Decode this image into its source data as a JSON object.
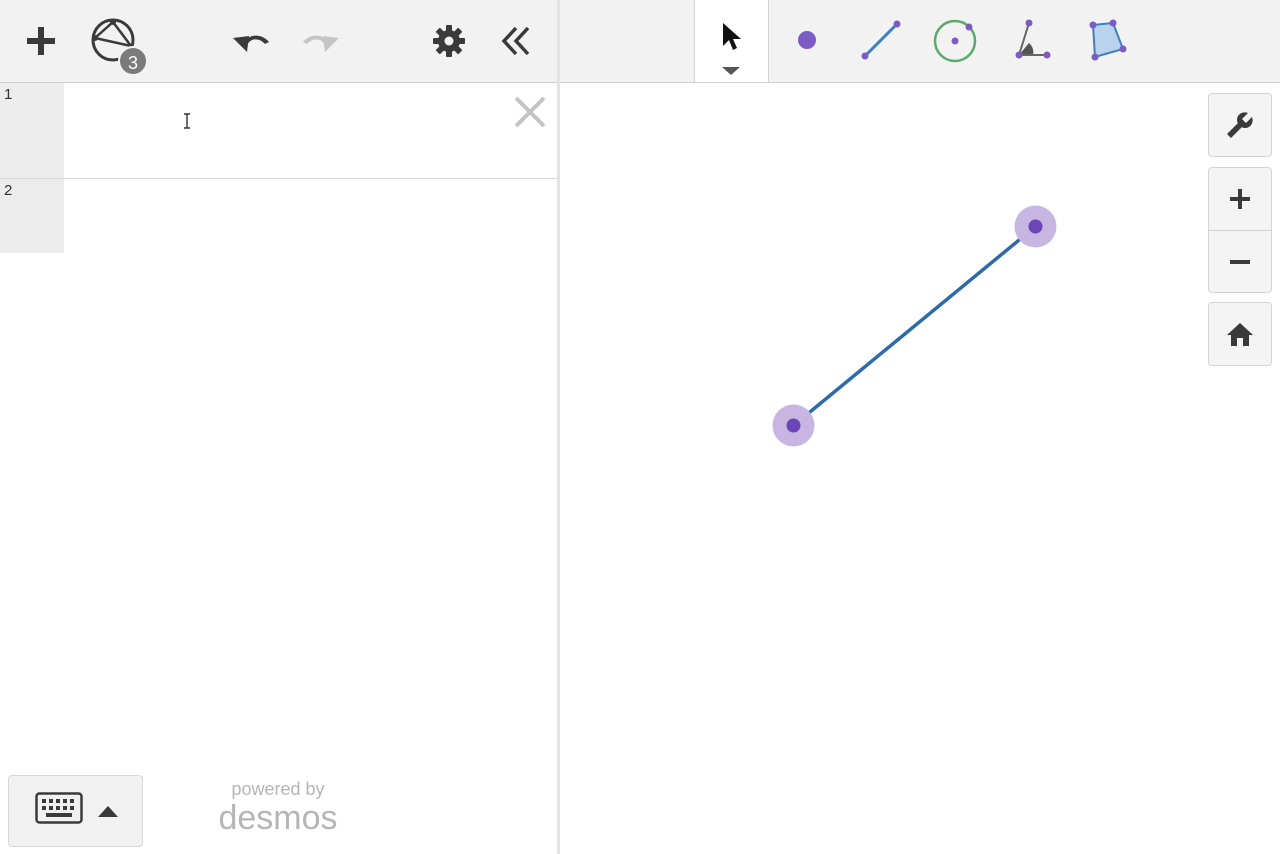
{
  "toolbar": {
    "add_icon": "plus-icon",
    "construction_icon": "geometry-tools-icon",
    "construction_badge": "3",
    "undo_icon": "undo-icon",
    "redo_icon": "redo-icon",
    "settings_icon": "gear-icon",
    "collapse_icon": "double-chevron-left-icon"
  },
  "expressions": [
    {
      "number": "1",
      "value": "",
      "close_icon": "close-icon"
    },
    {
      "number": "2",
      "value": ""
    }
  ],
  "footer": {
    "keypad_icon": "keyboard-icon",
    "keypad_toggle_icon": "caret-up-icon",
    "powered_by": "powered by",
    "brand": "desmos"
  },
  "graph_tools": [
    {
      "name": "select",
      "icon": "pointer-arrow-icon",
      "selected": true
    },
    {
      "name": "point",
      "icon": "point-icon"
    },
    {
      "name": "segment",
      "icon": "segment-icon"
    },
    {
      "name": "circle",
      "icon": "circle-icon"
    },
    {
      "name": "angle",
      "icon": "angle-icon"
    },
    {
      "name": "polygon",
      "icon": "polygon-icon"
    }
  ],
  "graph_controls": {
    "settings_icon": "wrench-icon",
    "zoom_in_icon": "plus-icon",
    "zoom_out_icon": "minus-icon",
    "home_icon": "home-icon"
  },
  "colors": {
    "point": "#6c46b8",
    "point_halo": "#c7b6e2",
    "segment": "#2d6aa8",
    "circle": "#5ea96a",
    "polygon_fill": "#b9d3ee",
    "toolbar_bg": "#f2f2f2",
    "icon_gray": "#555555"
  }
}
